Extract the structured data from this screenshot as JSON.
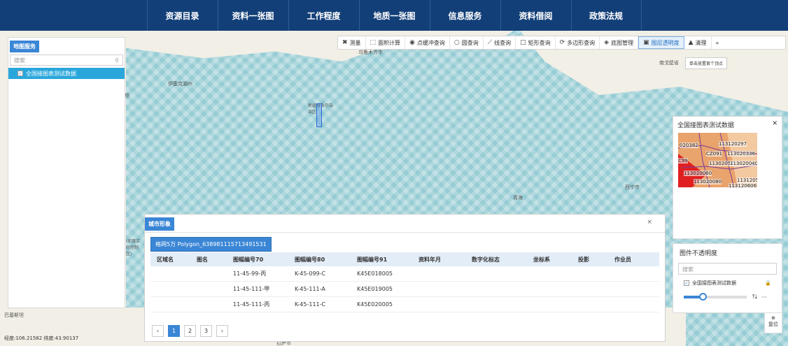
{
  "nav": {
    "items": [
      "资源目录",
      "资料一张图",
      "工作程度",
      "地质一张图",
      "信息服务",
      "资料借阅",
      "政策法规"
    ]
  },
  "toolbar": {
    "items": [
      {
        "label": "测量",
        "icon": "x-icon",
        "active": false
      },
      {
        "label": "面积计算",
        "icon": "area-icon",
        "active": false
      },
      {
        "label": "点缓冲查询",
        "icon": "point-buffer-icon",
        "active": false
      },
      {
        "label": "圆查询",
        "icon": "circle-icon",
        "active": false
      },
      {
        "label": "线查询",
        "icon": "line-icon",
        "active": false
      },
      {
        "label": "矩形查询",
        "icon": "rect-icon",
        "active": false
      },
      {
        "label": "多边形查询",
        "icon": "polygon-icon",
        "active": false
      },
      {
        "label": "底图管理",
        "icon": "layers-icon",
        "active": false
      },
      {
        "label": "图层透明度",
        "icon": "opacity-icon",
        "active": true
      },
      {
        "label": "清理",
        "icon": "broom-icon",
        "active": false
      }
    ],
    "collapse": "«"
  },
  "tooltip": "单击放置首个顶点",
  "map_labels": {
    "urumqi": "乌鲁木齐市",
    "lake": "伊塞克湖州",
    "region": "新疆维吾尔自治区",
    "xining": "西宁市",
    "nanmenggu": "南戈壁省",
    "qinghai": "青海",
    "bajisitan": "巴基斯坦",
    "tan": "坦",
    "indian_control": "(印度实际控制区)",
    "lasa": "拉萨市"
  },
  "left_panel": {
    "tab": "地图服务",
    "search_placeholder": "搜索",
    "layer": "全国接图表测试数据"
  },
  "legend_panel": {
    "title": "全国接图表测试数据",
    "labels": [
      "020382",
      "113120297",
      "CZ091",
      "113020336",
      "11302057",
      "113020040",
      "113020060",
      "11312054",
      "113020080",
      "113120606",
      "C99"
    ]
  },
  "opacity_panel": {
    "title": "图件不透明度",
    "search_placeholder": "搜索",
    "layer": "全国接图表测试数据",
    "slider_value": 0.3,
    "controls": "⤒⤓",
    "more": "···"
  },
  "relocate": {
    "label": "复位"
  },
  "status": "经度:106.21582 纬度:43.90137",
  "dialog": {
    "tab": "城市形象",
    "close": "×",
    "subtab": "格网5万 Polygon_638981115713491531",
    "columns": [
      "区域名",
      "图名",
      "图幅编号70",
      "图幅编号80",
      "图幅编号91",
      "资料年月",
      "数字化标志",
      "坐标系",
      "投影",
      "作业员"
    ],
    "rows": [
      [
        "",
        "",
        "11-45-99-丙",
        "K-45-099-C",
        "K45E018005",
        "",
        "",
        "",
        "",
        ""
      ],
      [
        "",
        "",
        "11-45-111-甲",
        "K-45-111-A",
        "K45E019005",
        "",
        "",
        "",
        "",
        ""
      ],
      [
        "",
        "",
        "11-45-111-丙",
        "K-45-111-C",
        "K45E020005",
        "",
        "",
        "",
        "",
        ""
      ]
    ],
    "pager": {
      "prev": "‹",
      "pages": [
        "1",
        "2",
        "3"
      ],
      "next": "›",
      "active": "1"
    }
  }
}
